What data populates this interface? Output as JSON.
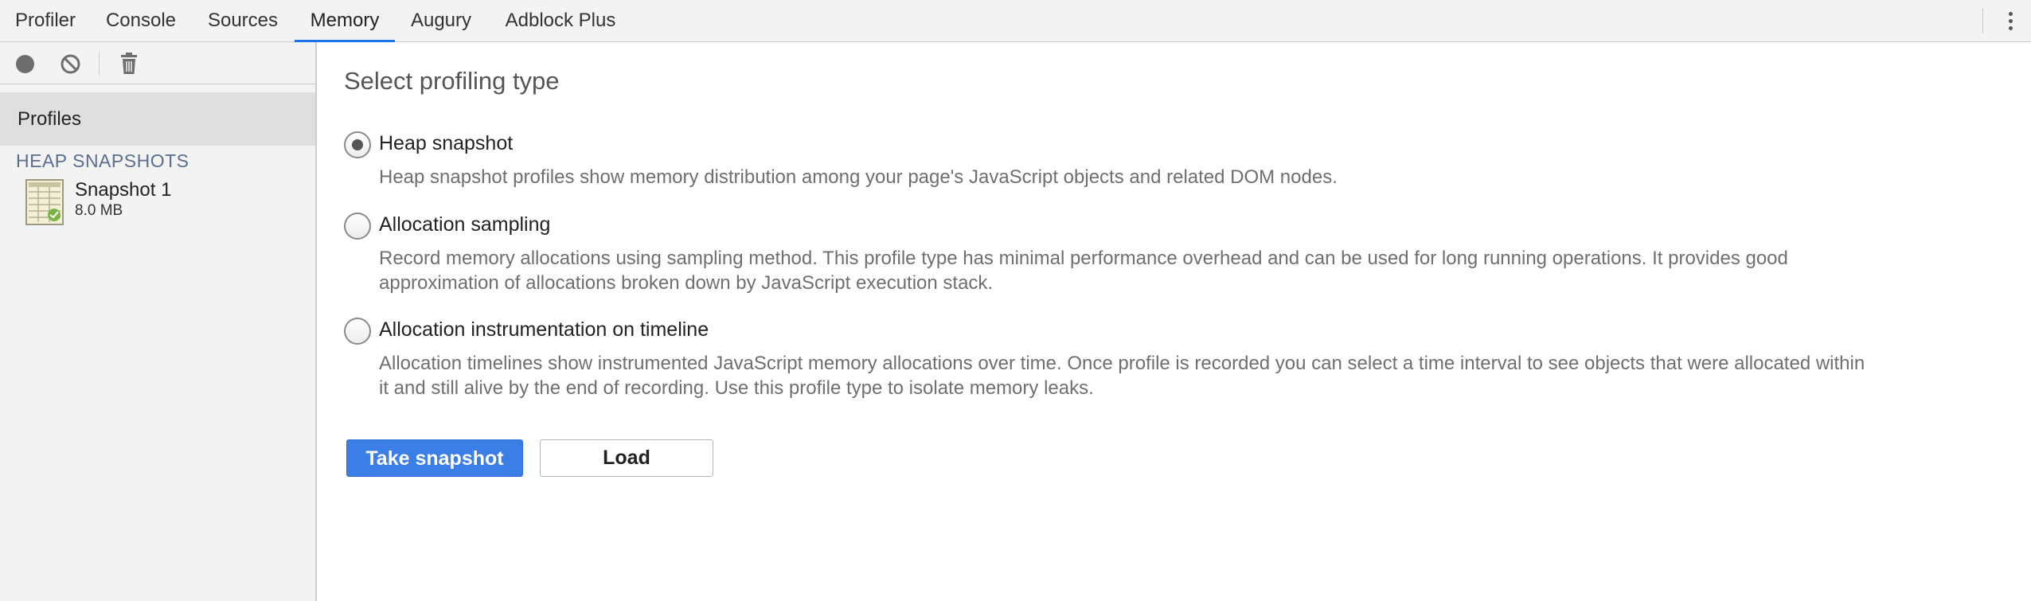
{
  "tabs": [
    "Profiler",
    "Console",
    "Sources",
    "Memory",
    "Augury",
    "Adblock Plus"
  ],
  "active_tab": "Memory",
  "toolbar": {
    "icons": [
      "record-icon",
      "clear-icon",
      "trash-icon"
    ]
  },
  "sidebar": {
    "profiles_label": "Profiles",
    "section_title": "HEAP SNAPSHOTS",
    "snapshots": [
      {
        "name": "Snapshot 1",
        "size": "8.0 MB"
      }
    ]
  },
  "main": {
    "title": "Select profiling type",
    "options": [
      {
        "label": "Heap snapshot",
        "checked": true,
        "desc_lines": [
          "Heap snapshot profiles show memory distribution among your page's JavaScript objects and related DOM nodes."
        ]
      },
      {
        "label": "Allocation sampling",
        "checked": false,
        "desc_lines": [
          "Record memory allocations using sampling method. This profile type has minimal performance overhead and can be used for long running operations. It provides good",
          "approximation of allocations broken down by JavaScript execution stack."
        ]
      },
      {
        "label": "Allocation instrumentation on timeline",
        "checked": false,
        "desc_lines": [
          "Allocation timelines show instrumented JavaScript memory allocations over time. Once profile is recorded you can select a time interval to see objects that were allocated within",
          "it and still alive by the end of recording. Use this profile type to isolate memory leaks."
        ]
      }
    ],
    "take_snapshot_label": "Take snapshot",
    "load_label": "Load"
  },
  "colors": {
    "accent": "#1a73e8",
    "primary_button": "#3b7ee6",
    "section_title": "#5a6e8e"
  }
}
